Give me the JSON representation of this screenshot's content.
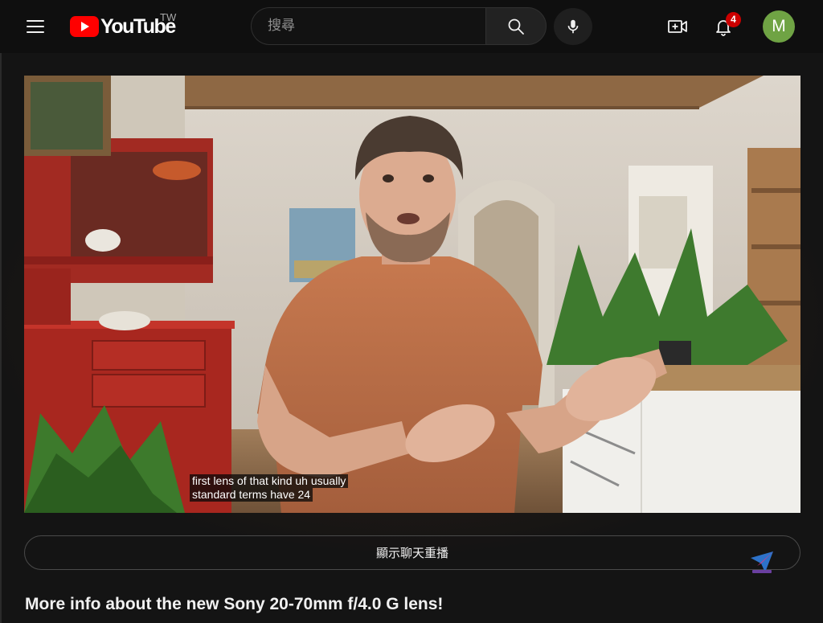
{
  "header": {
    "logo_text": "YouTube",
    "country_code": "TW",
    "search_placeholder": "搜尋",
    "notification_count": "4",
    "avatar_initial": "M"
  },
  "player": {
    "captions": [
      "first lens of that kind uh usually",
      "standard terms have 24"
    ]
  },
  "chat_replay_label": "顯示聊天重播",
  "video": {
    "title": "More info about the new Sony 20-70mm f/4.0 G lens!"
  },
  "colors": {
    "masthead_bg": "#0f0f0f",
    "brand_red": "#ff0000",
    "badge_red": "#cc0000",
    "avatar_green": "#6fa344"
  },
  "icons": {
    "menu": "hamburger-icon",
    "search": "search-icon",
    "mic": "microphone-icon",
    "create": "create-video-icon",
    "notifications": "bell-icon"
  }
}
